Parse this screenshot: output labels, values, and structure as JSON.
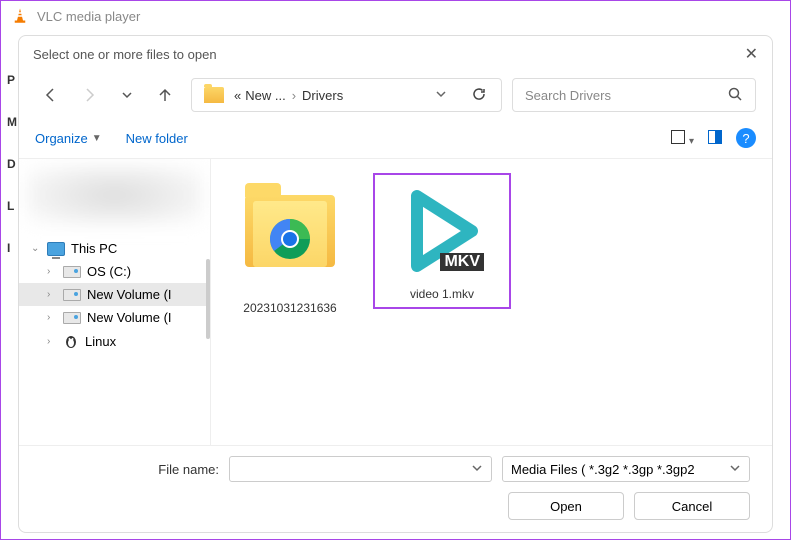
{
  "main_window": {
    "title": "VLC media player"
  },
  "dialog": {
    "title": "Select one or more files to open",
    "breadcrumb": {
      "prefix": "«",
      "parent": "New ...",
      "current": "Drivers"
    },
    "search": {
      "placeholder": "Search Drivers"
    },
    "toolbar": {
      "organize": "Organize",
      "newfolder": "New folder"
    },
    "tree": {
      "thispc": "This PC",
      "drives": [
        {
          "label": "OS (C:)"
        },
        {
          "label": "New Volume (I"
        },
        {
          "label": "New Volume (I"
        }
      ],
      "linux": "Linux"
    },
    "files": [
      {
        "name": "20231031231636",
        "type": "folder"
      },
      {
        "name": "video 1.mkv",
        "type": "mkv",
        "badge": "MKV",
        "selected": true
      }
    ],
    "footer": {
      "filename_label": "File name:",
      "filename_value": "",
      "filetype": "Media Files ( *.3g2 *.3gp *.3gp2",
      "open": "Open",
      "cancel": "Cancel"
    }
  },
  "edge_letters": [
    "P",
    "M",
    "D",
    "L",
    "I"
  ]
}
